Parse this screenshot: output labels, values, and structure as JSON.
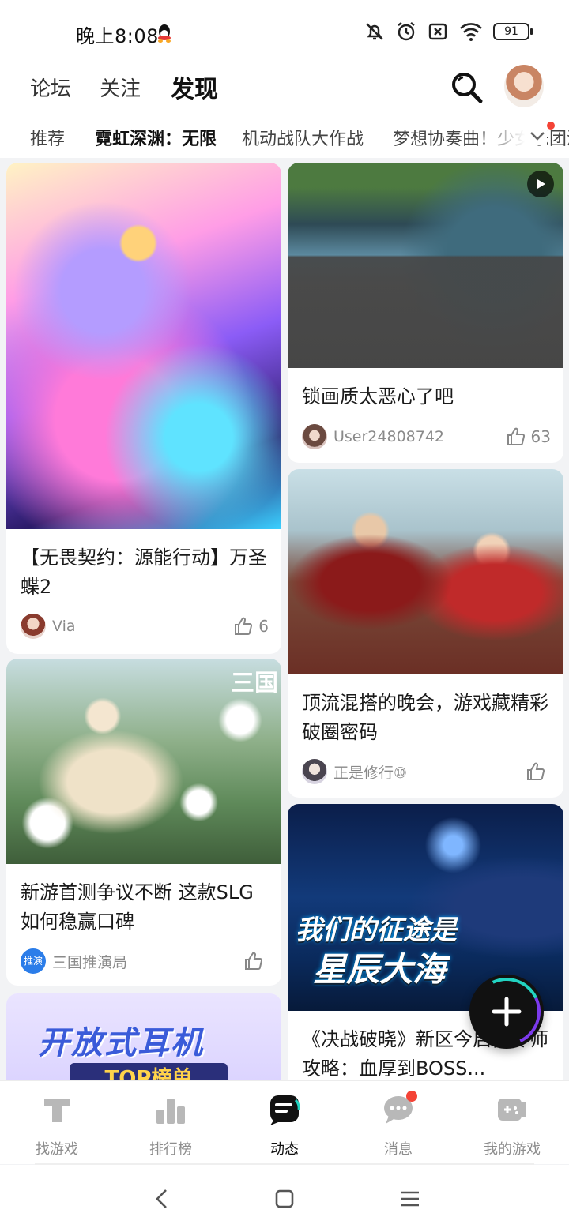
{
  "status_bar": {
    "time": "晚上8:08",
    "battery": "91",
    "icons": [
      "qq-icon",
      "mute-icon",
      "alarm-icon",
      "sim-off-icon",
      "wifi-icon",
      "battery-icon"
    ]
  },
  "top_nav": {
    "tabs": [
      {
        "label": "论坛",
        "active": false
      },
      {
        "label": "关注",
        "active": false
      },
      {
        "label": "发现",
        "active": true
      }
    ],
    "accent_color": "#24d3c1"
  },
  "sub_tabs": [
    "推荐",
    "霓虹深渊：无限",
    "机动战队大作战",
    "梦想协奏曲！少女乐团派对"
  ],
  "feed": {
    "left": [
      {
        "title": "【无畏契约：源能行动】万圣蝶2",
        "author": "Via",
        "likes": "6"
      },
      {
        "title": "新游首测争议不断 这款SLG如何稳赢口碑",
        "author": "三国推演局",
        "likes": "",
        "image_corner_text": "三国",
        "avatar_text": "推演"
      },
      {
        "ad_title": "开放式耳机",
        "ad_subtitle": "TOP榜单"
      }
    ],
    "right": [
      {
        "title": "锁画质太恶心了吧",
        "author": "User24808742",
        "likes": "63",
        "video": true
      },
      {
        "title": "顶流混搭的晚会，游戏藏精彩破圈密码",
        "author": "正是修行⑩",
        "likes": ""
      },
      {
        "title": "《决战破晓》新区今启，零氪攻略：血厚到BOSS…",
        "title_visible": "《决战破晓》新区今启，零师攻略：血厚到BOSS...",
        "image_text_line1": "我们的征途是",
        "image_text_line2": "星辰大海"
      }
    ]
  },
  "bottom_nav": [
    {
      "label": "找游戏",
      "icon": "find-game-icon",
      "active": false
    },
    {
      "label": "排行榜",
      "icon": "ranking-icon",
      "active": false
    },
    {
      "label": "动态",
      "icon": "feed-icon",
      "active": true
    },
    {
      "label": "消息",
      "icon": "message-icon",
      "active": false,
      "badge": true
    },
    {
      "label": "我的游戏",
      "icon": "my-games-icon",
      "active": false
    }
  ]
}
